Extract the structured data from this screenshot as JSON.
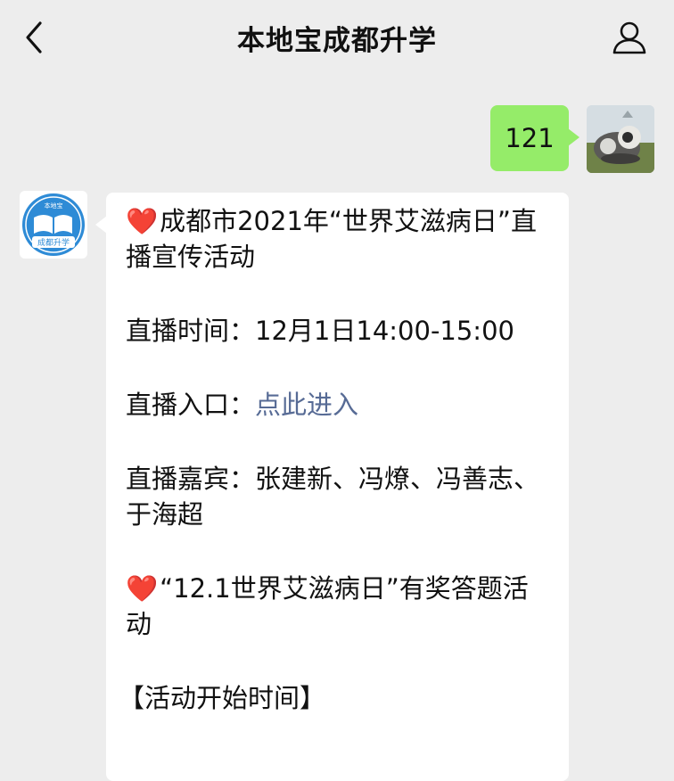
{
  "header": {
    "title": "本地宝成都升学"
  },
  "outgoing_message": {
    "text": "121"
  },
  "incoming_message": {
    "avatar_text": {
      "top": "本地宝",
      "bottom": "成都升学"
    },
    "heading": "成都市2021年“世界艾滋病日”直播宣传活动",
    "live_time_label": "直播时间：",
    "live_time_value": "12月1日14:00-15:00",
    "live_entry_label": "直播入口：",
    "live_entry_link": "点此进入",
    "guests_label": "直播嘉宾：",
    "guests_value": "张建新、冯燎、冯善志、于海超",
    "quiz_heading": "“12.1世界艾滋病日”有奖答题活动",
    "start_time_label": "【活动开始时间】"
  },
  "colors": {
    "background": "#ededed",
    "outgoing_bubble": "#95ec69",
    "incoming_bubble": "#ffffff",
    "link": "#576b95",
    "heart": "#e0242f"
  }
}
